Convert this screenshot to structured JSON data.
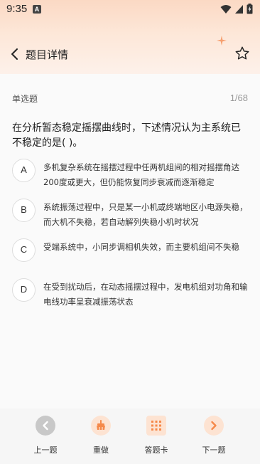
{
  "status_bar": {
    "time": "9:35",
    "notification_badge": "A"
  },
  "nav": {
    "title": "题目详情"
  },
  "question": {
    "type": "单选题",
    "progress": "1/68",
    "text": "在分析暂态稳定摇摆曲线时，下述情况认为主系统已不稳定的是(    )。"
  },
  "options": [
    {
      "letter": "A",
      "text": "多机复杂系统在摇摆过程中任两机组间的相对摇摆角达200度或更大，但仍能恢复同步衰减而逐渐稳定"
    },
    {
      "letter": "B",
      "text": "系统振荡过程中，只是某一小机或终端地区小电源失稳，而大机不失稳，若自动解列失稳小机时状况"
    },
    {
      "letter": "C",
      "text": "受端系统中，小同步调相机失效，而主要机组间不失稳"
    },
    {
      "letter": "D",
      "text": "在受到扰动后，在动态摇摆过程中，发电机组对功角和输电线功率呈衰减振荡状态"
    }
  ],
  "toolbar": {
    "prev_label": "上一题",
    "redo_label": "重做",
    "card_label": "答题卡",
    "next_label": "下一题"
  },
  "colors": {
    "accent": "#f5894a",
    "disabled": "#c8c8c8",
    "header_gradient_top": "#fbd9c4"
  }
}
